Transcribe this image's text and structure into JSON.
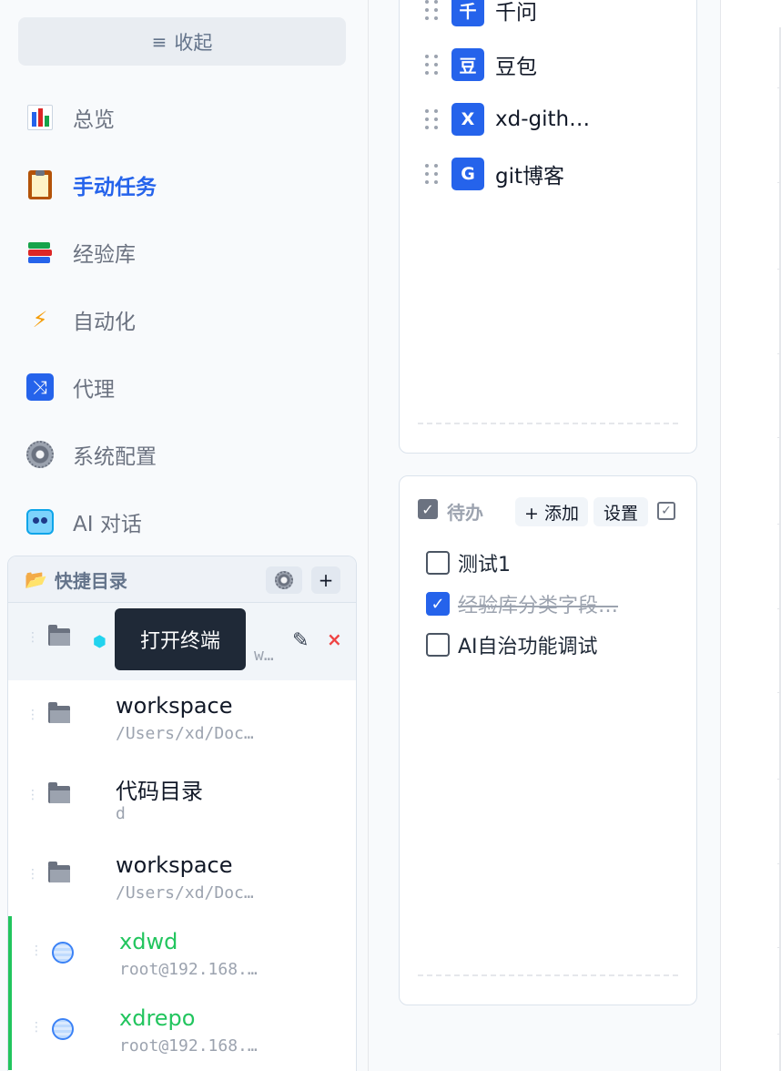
{
  "sidebar": {
    "collapse": {
      "icon": "≡",
      "label": "收起"
    },
    "nav": [
      {
        "icon": "chart-icon",
        "label": "总览",
        "active": false
      },
      {
        "icon": "clipboard-icon",
        "label": "手动任务",
        "active": true
      },
      {
        "icon": "books-icon",
        "label": "经验库",
        "active": false
      },
      {
        "icon": "lightning-icon",
        "label": "自动化",
        "active": false
      },
      {
        "icon": "shuffle-icon",
        "label": "代理",
        "active": false
      },
      {
        "icon": "gear-icon",
        "label": "系统配置",
        "active": false
      },
      {
        "icon": "robot-icon",
        "label": "AI 对话",
        "active": false
      }
    ],
    "accent_color": "#2563eb"
  },
  "quick_dirs": {
    "title": "快捷目录",
    "add_label": "+",
    "hover_row": {
      "path_fragment": "w…",
      "edit_icon": "✎",
      "delete_icon": "×"
    },
    "tooltip": "打开终端",
    "items": [
      {
        "type": "folder",
        "name": "workspace",
        "path": "/Users/xd/Doc…"
      },
      {
        "type": "folder",
        "name": "代码目录",
        "path": "d"
      },
      {
        "type": "folder",
        "name": "workspace",
        "path": "/Users/xd/Doc…"
      },
      {
        "type": "ssh",
        "name": "xdwd",
        "path": "root@192.168.…"
      },
      {
        "type": "ssh",
        "name": "xdrepo",
        "path": "root@192.168.…"
      }
    ],
    "ssh_color": "#22c55e"
  },
  "links": {
    "items": [
      {
        "badge": "千",
        "label": "千问"
      },
      {
        "badge": "豆",
        "label": "豆包"
      },
      {
        "badge": "X",
        "label": "xd-gith…"
      },
      {
        "badge": "G",
        "label": "git博客"
      }
    ]
  },
  "todo": {
    "title": "待办",
    "add_label": "+ 添加",
    "settings_label": "设置",
    "items": [
      {
        "label": "测试1",
        "done": false
      },
      {
        "label": "经验库分类字段…",
        "done": true
      },
      {
        "label": "AI自治功能调试",
        "done": false
      }
    ]
  }
}
